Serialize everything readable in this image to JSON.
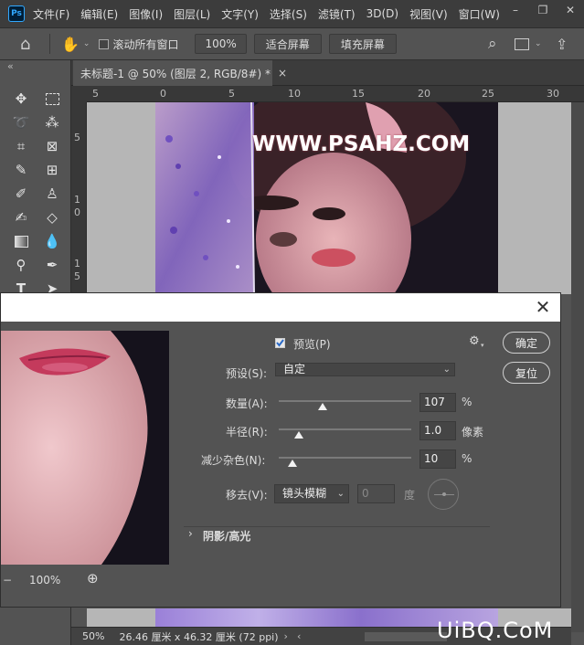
{
  "app": {
    "logo_text": "Ps"
  },
  "menu": [
    "文件(F)",
    "编辑(E)",
    "图像(I)",
    "图层(L)",
    "文字(Y)",
    "选择(S)",
    "滤镜(T)",
    "3D(D)",
    "视图(V)",
    "窗口(W)"
  ],
  "window_controls": {
    "minimize": "–",
    "restore": "❐",
    "close": "✕"
  },
  "options_bar": {
    "scroll_all_windows": "滚动所有窗口",
    "zoom_value": "100%",
    "fit_screen": "适合屏幕",
    "fill_screen": "填充屏幕"
  },
  "panel_collapse": "«",
  "document_tab": {
    "title": "未标题-1 @ 50% (图层 2, RGB/8#) *",
    "close": "×"
  },
  "ruler_h": [
    "5",
    "0",
    "5",
    "10",
    "15",
    "20",
    "25",
    "30"
  ],
  "ruler_v": [
    "5",
    "1",
    "0",
    "1",
    "5"
  ],
  "canvas": {
    "watermark_text": "WWW.PSAHZ.COM"
  },
  "dialog": {
    "close": "✕",
    "preview_label": "预览(P)",
    "preview_checked": true,
    "ok_button": "确定",
    "reset_button": "复位",
    "preset_label": "预设(S):",
    "preset_value": "自定",
    "amount_label": "数量(A):",
    "amount_value": "107",
    "amount_unit": "%",
    "amount_level": 0.33,
    "radius_label": "半径(R):",
    "radius_value": "1.0",
    "radius_unit": "像素",
    "radius_level": 0.15,
    "noise_label": "减少杂色(N):",
    "noise_value": "10",
    "noise_unit": "%",
    "noise_level": 0.1,
    "remove_label": "移去(V):",
    "remove_value": "镜头模糊",
    "angle_value": "0",
    "angle_unit": "度",
    "section_label": "阴影/高光",
    "zoom_level": "100%"
  },
  "status": {
    "zoom": "50%",
    "doc_size": "26.46 厘米 x 46.32 厘米 (72 ppi)"
  },
  "watermark": "UiBQ.CoM",
  "icons": {
    "home": "⌂",
    "hand": "✋",
    "search": "⌕",
    "share": "⇪",
    "zoom_in": "⊕",
    "gear": "⚙"
  },
  "colors": {
    "accent": "#31a8ff",
    "panel": "#535353",
    "dark": "#3c3c3c"
  }
}
